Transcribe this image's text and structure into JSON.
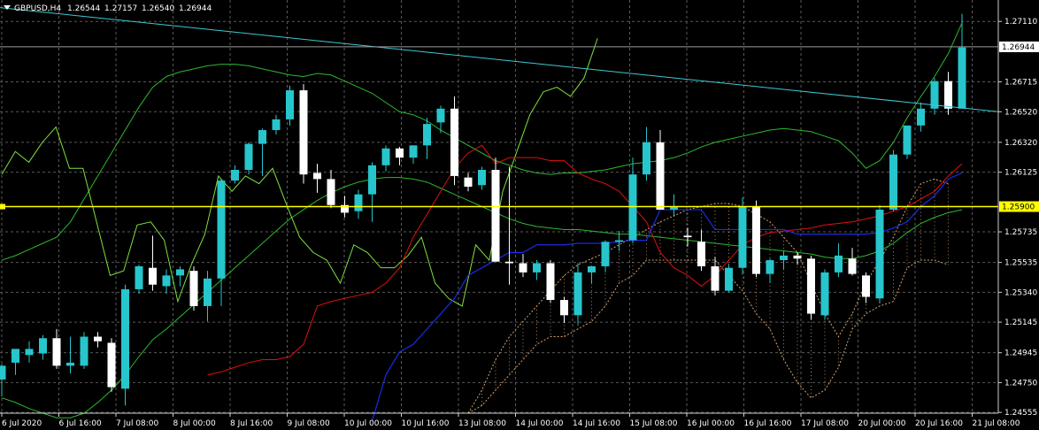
{
  "header": {
    "symbol": "GBPUSD,H4",
    "open": "1.26544",
    "high": "1.27157",
    "low": "1.26540",
    "close": "1.26944"
  },
  "price_axis": {
    "ticks": [
      "1.27110",
      "1.26715",
      "1.26520",
      "1.26320",
      "1.26125",
      "1.25735",
      "1.25535",
      "1.25340",
      "1.25145",
      "1.24945",
      "1.24750",
      "1.24555"
    ],
    "current_price_label": "1.26944",
    "hline_price_label": "1.25900"
  },
  "time_axis": {
    "labels": [
      "6 Jul 2020",
      "6 Jul 16:00",
      "7 Jul 08:00",
      "8 Jul 00:00",
      "8 Jul 16:00",
      "9 Jul 08:00",
      "10 Jul 00:00",
      "10 Jul 16:00",
      "13 Jul 08:00",
      "14 Jul 00:00",
      "14 Jul 16:00",
      "15 Jul 08:00",
      "16 Jul 00:00",
      "16 Jul 16:00",
      "17 Jul 08:00",
      "20 Jul 00:00",
      "20 Jul 16:00",
      "21 Jul 08:00"
    ]
  },
  "colors": {
    "background": "#000000",
    "grid": "#5a5a5a",
    "bull_candle": "#26c6cc",
    "bear_candle": "#ffffff",
    "bollinger": "#2db82d",
    "oscillator": "#7fe040",
    "tenkan": "#e01010",
    "kijun": "#1a2be6",
    "kumo": "#d9a06b",
    "trendline": "#3fc9d4",
    "hline": "#ffff00"
  },
  "chart_data": {
    "type": "candlestick",
    "ylim": [
      1.2455,
      1.2725
    ],
    "hline": 1.259,
    "candles": [
      {
        "o": 1.2477,
        "h": 1.2487,
        "l": 1.2466,
        "c": 1.2486
      },
      {
        "o": 1.2488,
        "h": 1.2495,
        "l": 1.248,
        "c": 1.2497
      },
      {
        "o": 1.2493,
        "h": 1.2502,
        "l": 1.2488,
        "c": 1.2497
      },
      {
        "o": 1.2494,
        "h": 1.2506,
        "l": 1.249,
        "c": 1.2504
      },
      {
        "o": 1.2504,
        "h": 1.251,
        "l": 1.2484,
        "c": 1.2486
      },
      {
        "o": 1.2486,
        "h": 1.2505,
        "l": 1.2481,
        "c": 1.2488
      },
      {
        "o": 1.2486,
        "h": 1.2508,
        "l": 1.2484,
        "c": 1.2505
      },
      {
        "o": 1.2505,
        "h": 1.2508,
        "l": 1.2498,
        "c": 1.2502
      },
      {
        "o": 1.2501,
        "h": 1.2504,
        "l": 1.2469,
        "c": 1.2472
      },
      {
        "o": 1.2471,
        "h": 1.2539,
        "l": 1.246,
        "c": 1.2536
      },
      {
        "o": 1.2536,
        "h": 1.2552,
        "l": 1.2533,
        "c": 1.2551
      },
      {
        "o": 1.255,
        "h": 1.2571,
        "l": 1.2535,
        "c": 1.2539
      },
      {
        "o": 1.2538,
        "h": 1.2549,
        "l": 1.2533,
        "c": 1.2545
      },
      {
        "o": 1.2545,
        "h": 1.2551,
        "l": 1.2538,
        "c": 1.2549
      },
      {
        "o": 1.2548,
        "h": 1.2551,
        "l": 1.2522,
        "c": 1.2525
      },
      {
        "o": 1.2525,
        "h": 1.2548,
        "l": 1.2515,
        "c": 1.2543
      },
      {
        "o": 1.2543,
        "h": 1.2608,
        "l": 1.2525,
        "c": 1.2607
      },
      {
        "o": 1.2607,
        "h": 1.2617,
        "l": 1.2605,
        "c": 1.2614
      },
      {
        "o": 1.2614,
        "h": 1.2632,
        "l": 1.2611,
        "c": 1.2631
      },
      {
        "o": 1.2631,
        "h": 1.2641,
        "l": 1.261,
        "c": 1.264
      },
      {
        "o": 1.264,
        "h": 1.265,
        "l": 1.2637,
        "c": 1.2647
      },
      {
        "o": 1.2647,
        "h": 1.2669,
        "l": 1.2643,
        "c": 1.2666
      },
      {
        "o": 1.2666,
        "h": 1.267,
        "l": 1.2605,
        "c": 1.2611
      },
      {
        "o": 1.2612,
        "h": 1.2618,
        "l": 1.2599,
        "c": 1.2608
      },
      {
        "o": 1.2608,
        "h": 1.2614,
        "l": 1.2589,
        "c": 1.2591
      },
      {
        "o": 1.2591,
        "h": 1.2597,
        "l": 1.2583,
        "c": 1.2586
      },
      {
        "o": 1.2587,
        "h": 1.2601,
        "l": 1.2582,
        "c": 1.2598
      },
      {
        "o": 1.2598,
        "h": 1.2619,
        "l": 1.258,
        "c": 1.2617
      },
      {
        "o": 1.2617,
        "h": 1.263,
        "l": 1.2613,
        "c": 1.2628
      },
      {
        "o": 1.2628,
        "h": 1.2629,
        "l": 1.2617,
        "c": 1.2622
      },
      {
        "o": 1.2622,
        "h": 1.2629,
        "l": 1.2618,
        "c": 1.263
      },
      {
        "o": 1.263,
        "h": 1.2648,
        "l": 1.2621,
        "c": 1.2644
      },
      {
        "o": 1.2645,
        "h": 1.2656,
        "l": 1.2638,
        "c": 1.2654
      },
      {
        "o": 1.2654,
        "h": 1.2662,
        "l": 1.2604,
        "c": 1.261
      },
      {
        "o": 1.2609,
        "h": 1.2612,
        "l": 1.26,
        "c": 1.2603
      },
      {
        "o": 1.2604,
        "h": 1.2616,
        "l": 1.2601,
        "c": 1.2614
      },
      {
        "o": 1.2614,
        "h": 1.2622,
        "l": 1.2592,
        "c": 1.2554
      },
      {
        "o": 1.2554,
        "h": 1.2616,
        "l": 1.2539,
        "c": 1.2553
      },
      {
        "o": 1.2553,
        "h": 1.2559,
        "l": 1.2544,
        "c": 1.2547
      },
      {
        "o": 1.2547,
        "h": 1.2555,
        "l": 1.2542,
        "c": 1.2553
      },
      {
        "o": 1.2553,
        "h": 1.2555,
        "l": 1.2527,
        "c": 1.2529
      },
      {
        "o": 1.2529,
        "h": 1.2531,
        "l": 1.2514,
        "c": 1.2519
      },
      {
        "o": 1.2519,
        "h": 1.2553,
        "l": 1.2513,
        "c": 1.2547
      },
      {
        "o": 1.2547,
        "h": 1.2551,
        "l": 1.254,
        "c": 1.2551
      },
      {
        "o": 1.2551,
        "h": 1.2568,
        "l": 1.2547,
        "c": 1.2567
      },
      {
        "o": 1.2567,
        "h": 1.2574,
        "l": 1.2561,
        "c": 1.2568
      },
      {
        "o": 1.2568,
        "h": 1.2622,
        "l": 1.2566,
        "c": 1.2611
      },
      {
        "o": 1.2611,
        "h": 1.2642,
        "l": 1.2607,
        "c": 1.2632
      },
      {
        "o": 1.2632,
        "h": 1.264,
        "l": 1.259,
        "c": 1.2588
      },
      {
        "o": 1.2588,
        "h": 1.2598,
        "l": 1.2584,
        "c": 1.259
      },
      {
        "o": 1.2571,
        "h": 1.2576,
        "l": 1.2564,
        "c": 1.257
      },
      {
        "o": 1.2567,
        "h": 1.2575,
        "l": 1.2548,
        "c": 1.2551
      },
      {
        "o": 1.2551,
        "h": 1.2557,
        "l": 1.2532,
        "c": 1.2535
      },
      {
        "o": 1.2535,
        "h": 1.2552,
        "l": 1.2534,
        "c": 1.255
      },
      {
        "o": 1.255,
        "h": 1.2596,
        "l": 1.2546,
        "c": 1.259
      },
      {
        "o": 1.259,
        "h": 1.2594,
        "l": 1.2544,
        "c": 1.2546
      },
      {
        "o": 1.2546,
        "h": 1.2556,
        "l": 1.254,
        "c": 1.2555
      },
      {
        "o": 1.2555,
        "h": 1.2561,
        "l": 1.2549,
        "c": 1.2558
      },
      {
        "o": 1.2558,
        "h": 1.256,
        "l": 1.2552,
        "c": 1.2556
      },
      {
        "o": 1.2556,
        "h": 1.2558,
        "l": 1.2516,
        "c": 1.252
      },
      {
        "o": 1.2519,
        "h": 1.2549,
        "l": 1.2516,
        "c": 1.2547
      },
      {
        "o": 1.2547,
        "h": 1.2566,
        "l": 1.2544,
        "c": 1.2558
      },
      {
        "o": 1.2556,
        "h": 1.2563,
        "l": 1.2545,
        "c": 1.2546
      },
      {
        "o": 1.2545,
        "h": 1.2547,
        "l": 1.2527,
        "c": 1.2531
      },
      {
        "o": 1.253,
        "h": 1.2591,
        "l": 1.2527,
        "c": 1.2588
      },
      {
        "o": 1.2588,
        "h": 1.2627,
        "l": 1.2587,
        "c": 1.2624
      },
      {
        "o": 1.2624,
        "h": 1.2643,
        "l": 1.2621,
        "c": 1.2643
      },
      {
        "o": 1.2643,
        "h": 1.2658,
        "l": 1.2639,
        "c": 1.2654
      },
      {
        "o": 1.2654,
        "h": 1.2674,
        "l": 1.265,
        "c": 1.2672
      },
      {
        "o": 1.2672,
        "h": 1.2678,
        "l": 1.265,
        "c": 1.2654
      },
      {
        "o": 1.2654,
        "h": 1.2716,
        "l": 1.2654,
        "c": 1.2694
      }
    ],
    "bollinger_upper": [
      1.2555,
      1.2558,
      1.2562,
      1.2566,
      1.257,
      1.258,
      1.2595,
      1.261,
      1.2625,
      1.264,
      1.2655,
      1.2668,
      1.2675,
      1.2678,
      1.268,
      1.2682,
      1.2683,
      1.2683,
      1.2682,
      1.268,
      1.2678,
      1.2676,
      1.2675,
      1.2677,
      1.2676,
      1.2672,
      1.2668,
      1.2664,
      1.2658,
      1.2652,
      1.265,
      1.2646,
      1.264,
      1.2635,
      1.263,
      1.2625,
      1.262,
      1.2617,
      1.2614,
      1.2612,
      1.2611,
      1.2612,
      1.2612,
      1.2613,
      1.2614,
      1.2616,
      1.2618,
      1.2619,
      1.262,
      1.2622,
      1.2625,
      1.2629,
      1.2632,
      1.2634,
      1.2636,
      1.2638,
      1.264,
      1.2641,
      1.264,
      1.2639,
      1.2636,
      1.2633,
      1.2625,
      1.2615,
      1.262,
      1.2632,
      1.2648,
      1.2662,
      1.2675,
      1.269,
      1.271
    ],
    "bollinger_lower": [
      1.2465,
      1.2462,
      1.2458,
      1.2455,
      1.2452,
      1.2452,
      1.2455,
      1.2462,
      1.247,
      1.248,
      1.2492,
      1.2503,
      1.251,
      1.2518,
      1.2526,
      1.2534,
      1.2542,
      1.255,
      1.2558,
      1.2566,
      1.2574,
      1.2582,
      1.2588,
      1.2594,
      1.2599,
      1.2603,
      1.2606,
      1.2608,
      1.2609,
      1.2609,
      1.2608,
      1.2606,
      1.2602,
      1.2598,
      1.2594,
      1.259,
      1.2586,
      1.2582,
      1.2579,
      1.2577,
      1.2576,
      1.2575,
      1.2575,
      1.2574,
      1.2573,
      1.2572,
      1.2572,
      1.2571,
      1.257,
      1.2569,
      1.2568,
      1.2567,
      1.2566,
      1.2565,
      1.2564,
      1.2563,
      1.2562,
      1.2561,
      1.256,
      1.2559,
      1.2557,
      1.2556,
      1.2556,
      1.2558,
      1.2561,
      1.2566,
      1.2573,
      1.2579,
      1.2583,
      1.2586,
      1.2588
    ],
    "oscillator": [
      1.2611,
      1.2626,
      1.2619,
      1.2632,
      1.2642,
      1.2615,
      1.2615,
      1.258,
      1.2545,
      1.2548,
      1.2578,
      1.258,
      1.2568,
      1.2528,
      1.2552,
      1.2572,
      1.261,
      1.26,
      1.261,
      1.2605,
      1.2615,
      1.2592,
      1.257,
      1.256,
      1.2555,
      1.254,
      1.2565,
      1.256,
      1.255,
      1.255,
      1.2558,
      1.257,
      1.254,
      1.253,
      1.2525,
      1.2565,
      1.2555,
      1.26,
      1.2625,
      1.265,
      1.2665,
      1.2668,
      1.2662,
      1.2674,
      1.27
    ],
    "tenkan": [
      1.248,
      1.2482,
      1.2485,
      1.2488,
      1.249,
      1.249,
      1.2492,
      1.25,
      1.2525,
      1.2528,
      1.253,
      1.2532,
      1.2534,
      1.254,
      1.255,
      1.257,
      1.2585,
      1.26,
      1.2615,
      1.2625,
      1.263,
      1.2618,
      1.2622,
      1.2622,
      1.2622,
      1.262,
      1.262,
      1.2612,
      1.2608,
      1.2605,
      1.26,
      1.259,
      1.258,
      1.256,
      1.255,
      1.2545,
      1.2538,
      1.2545,
      1.2555,
      1.2565,
      1.257,
      1.2573,
      1.2574,
      1.2575,
      1.2576,
      1.2578,
      1.2579,
      1.258,
      1.2582,
      1.2584,
      1.2587,
      1.259,
      1.2595,
      1.26,
      1.261,
      1.2618
    ],
    "kijun": [
      1.245,
      1.248,
      1.2495,
      1.25,
      1.251,
      1.252,
      1.253,
      1.2545,
      1.255,
      1.2555,
      1.256,
      1.256,
      1.2565,
      1.2565,
      1.2565,
      1.2566,
      1.2566,
      1.2566,
      1.2567,
      1.2568,
      1.2568,
      1.2588,
      1.2588,
      1.2588,
      1.2588,
      1.2575,
      1.2575,
      1.2575,
      1.2575,
      1.2575,
      1.2575,
      1.2572,
      1.2572,
      1.2572,
      1.2572,
      1.2572,
      1.2572,
      1.2573,
      1.2576,
      1.258,
      1.259,
      1.2597,
      1.2608,
      1.2612
    ],
    "trendline": {
      "from": 1.272,
      "to": 1.2652
    },
    "kumo": {
      "span_a": [
        1.2455,
        1.247,
        1.249,
        1.2505,
        1.2515,
        1.2525,
        1.2535,
        1.2545,
        1.2552,
        1.2556,
        1.256,
        1.2565,
        1.257,
        1.2575,
        1.258,
        1.2584,
        1.2588,
        1.259,
        1.2592,
        1.2592,
        1.259,
        1.2585,
        1.258,
        1.257,
        1.256,
        1.254,
        1.252,
        1.2505,
        1.252,
        1.254,
        1.2555,
        1.257,
        1.259,
        1.2605,
        1.2608,
        1.2605
      ],
      "span_b": [
        1.2455,
        1.246,
        1.247,
        1.248,
        1.249,
        1.25,
        1.2505,
        1.2505,
        1.251,
        1.2515,
        1.2525,
        1.254,
        1.2545,
        1.2555,
        1.2555,
        1.2555,
        1.2555,
        1.2555,
        1.2555,
        1.2545,
        1.2535,
        1.252,
        1.251,
        1.249,
        1.2475,
        1.2465,
        1.247,
        1.2485,
        1.251,
        1.252,
        1.2525,
        1.2528,
        1.255,
        1.2555,
        1.2555,
        1.2552
      ]
    }
  }
}
